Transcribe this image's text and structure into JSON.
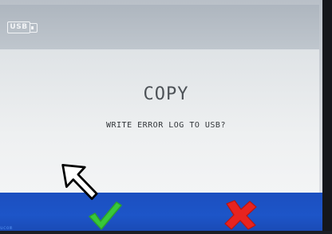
{
  "status_bar": {
    "usb_label": "USB",
    "usb_icon": "usb-drive-icon"
  },
  "dialog": {
    "title": "COPY",
    "message": "WRITE ERROR LOG TO USB?"
  },
  "actions": {
    "confirm_icon": "checkmark-icon",
    "cancel_icon": "x-icon",
    "confirm_color": "#38c83a",
    "cancel_color": "#e8231f",
    "bar_color": "#1d55c8"
  },
  "bottom_label": "ucom",
  "annotation": {
    "pointer_icon": "pointer-arrow-icon"
  }
}
